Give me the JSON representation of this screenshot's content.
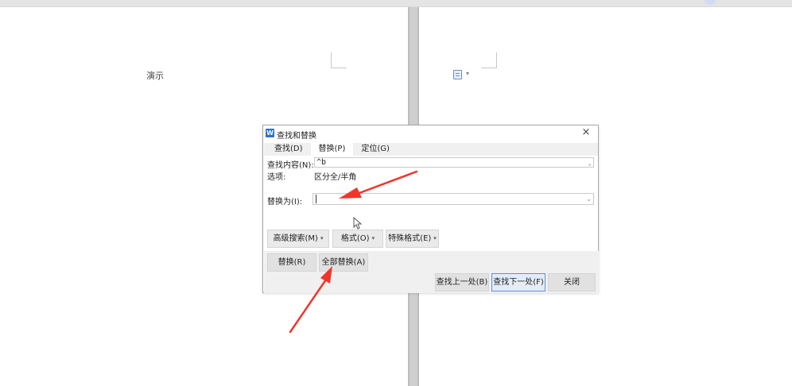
{
  "document": {
    "text": "演示"
  },
  "icons": {
    "paste_options": "paste-icon",
    "paste_caret": "▾",
    "app": "wps-writer-icon",
    "close": "close-icon"
  },
  "dialog": {
    "app_icon_glyph": "W",
    "title": "查找和替换",
    "close_glyph": "×",
    "tabs": [
      {
        "label": "查找(D)"
      },
      {
        "label": "替换(P)"
      },
      {
        "label": "定位(G)"
      }
    ],
    "find": {
      "label": "查找内容(N):",
      "value": "^b"
    },
    "options": {
      "label": "选项:",
      "value": "区分全/半角"
    },
    "replace": {
      "label": "替换为(I):",
      "value": ""
    },
    "buttons": {
      "advanced_search": "高级搜索(M)",
      "format": "格式(O)",
      "special_format": "特殊格式(E)",
      "replace": "替换(R)",
      "replace_all": "全部替换(A)",
      "find_previous": "查找上一处(B)",
      "find_next": "查找下一处(F)",
      "close": "关闭"
    }
  },
  "colors": {
    "annotation_arrow": "#f0352a",
    "accent": "#2f6fd6"
  }
}
